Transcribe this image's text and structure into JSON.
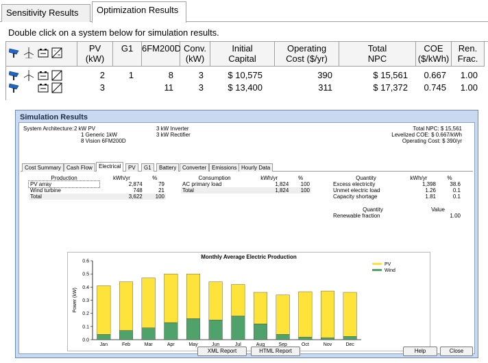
{
  "tabs": {
    "sensitivity": "Sensitivity Results",
    "optimization": "Optimization Results"
  },
  "instruction": "Double click on a system below for simulation results.",
  "grid": {
    "headers": [
      "PV\n(kW)",
      "G1",
      "6FM200D",
      "Conv.\n(kW)",
      "Initial\nCapital",
      "Operating\nCost ($/yr)",
      "Total\nNPC",
      "COE\n($/kWh)",
      "Ren.\nFrac."
    ],
    "rows": [
      {
        "pv": "2",
        "g1": "1",
        "battery": "8",
        "conv": "3",
        "capital": "$ 10,575",
        "operating": "390",
        "npc": "$ 15,561",
        "coe": "0.667",
        "ren": "1.00"
      },
      {
        "pv": "3",
        "g1": "",
        "battery": "11",
        "conv": "3",
        "capital": "$ 13,400",
        "operating": "311",
        "npc": "$ 17,372",
        "coe": "0.745",
        "ren": "1.00"
      }
    ]
  },
  "icons": {
    "pv": "pv-panel-icon",
    "wind": "wind-turbine-icon",
    "battery": "battery-icon",
    "converter": "converter-icon"
  },
  "dialog": {
    "title": "Simulation Results",
    "architecture_label": "System Architecture:",
    "arch_left": [
      "2 kW PV",
      "1 Generic 1kW",
      "8 Vision 6FM200D"
    ],
    "arch_right": [
      "3 kW Inverter",
      "3 kW Rectifier"
    ],
    "summary": [
      "Total NPC:  $ 15,561",
      "Levelized COE:  $ 0.667/kWh",
      "Operating Cost:  $ 390/yr"
    ],
    "subtabs": [
      "Cost Summary",
      "Cash Flow",
      "Electrical",
      "PV",
      "G1",
      "Battery",
      "Converter",
      "Emissions",
      "Hourly Data"
    ],
    "production": {
      "headers": [
        "Production",
        "kWh/yr",
        "%"
      ],
      "rows": [
        [
          "PV array",
          "2,874",
          "79"
        ],
        [
          "Wind turbine",
          "748",
          "21"
        ]
      ],
      "total": [
        "Total",
        "3,622",
        "100"
      ]
    },
    "consumption": {
      "headers": [
        "Consumption",
        "kWh/yr",
        "%"
      ],
      "rows": [
        [
          "AC primary load",
          "1,824",
          "100"
        ]
      ],
      "total": [
        "Total",
        "1,824",
        "100"
      ]
    },
    "quantity": {
      "headers": [
        "Quantity",
        "kWh/yr",
        "%"
      ],
      "rows": [
        [
          "Excess electricity",
          "1,398",
          "38.6"
        ],
        [
          "Unmet electric load",
          "1.26",
          "0.1"
        ],
        [
          "Capacity shortage",
          "1.81",
          "0.1"
        ]
      ]
    },
    "renewable": {
      "headers": [
        "Quantity",
        "Value"
      ],
      "rows": [
        [
          "Renewable fraction",
          "1.00"
        ]
      ]
    },
    "buttons": {
      "xml": "XML Report",
      "html": "HTML Report",
      "help": "Help",
      "close": "Close"
    }
  },
  "chart_data": {
    "type": "bar",
    "stacked": true,
    "title": "Monthly Average Electric Production",
    "ylabel": "Power (kW)",
    "xlabel": "",
    "ylim": [
      0,
      0.6
    ],
    "yticks": [
      "0.0",
      "0.1",
      "0.2",
      "0.3",
      "0.4",
      "0.5",
      "0.6"
    ],
    "categories": [
      "Jan",
      "Feb",
      "Mar",
      "Apr",
      "May",
      "Jun",
      "Jul",
      "Aug",
      "Sep",
      "Oct",
      "Nov",
      "Dec"
    ],
    "series": [
      {
        "name": "Wind",
        "color": "#4fa36a",
        "values": [
          0.04,
          0.07,
          0.09,
          0.13,
          0.16,
          0.15,
          0.18,
          0.12,
          0.04,
          0.02,
          0.015,
          0.025
        ]
      },
      {
        "name": "PV",
        "color": "#fde33a",
        "values": [
          0.37,
          0.37,
          0.38,
          0.37,
          0.34,
          0.29,
          0.24,
          0.24,
          0.3,
          0.345,
          0.355,
          0.335
        ]
      }
    ],
    "legend": "top-right",
    "legend_order": [
      "PV",
      "Wind"
    ],
    "grid": false
  }
}
